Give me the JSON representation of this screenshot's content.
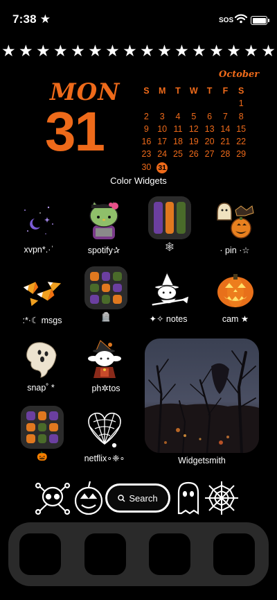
{
  "status_bar": {
    "time": "7:38 ★",
    "sos": "SOS"
  },
  "header_stars": [
    "★",
    "★",
    "★",
    "★",
    "★",
    "★",
    "★",
    "★",
    "★",
    "★",
    "★",
    "★",
    "★",
    "★",
    "★",
    "★"
  ],
  "date_widget": {
    "day_name": "MON",
    "day_number": "31"
  },
  "calendar": {
    "month": "October",
    "weekdays": [
      "S",
      "M",
      "T",
      "W",
      "T",
      "F",
      "S"
    ],
    "weeks": [
      [
        "",
        "",
        "",
        "",
        "",
        "",
        "1"
      ],
      [
        "2",
        "3",
        "4",
        "5",
        "6",
        "7",
        "8"
      ],
      [
        "9",
        "10",
        "11",
        "12",
        "13",
        "14",
        "15"
      ],
      [
        "16",
        "17",
        "18",
        "19",
        "20",
        "21",
        "22"
      ],
      [
        "23",
        "24",
        "25",
        "26",
        "27",
        "28",
        "29"
      ],
      [
        "30",
        "31",
        "",
        "",
        "",
        "",
        ""
      ]
    ],
    "today": "31",
    "accent": "#ee6a1a"
  },
  "widget_label": "Color Widgets",
  "apps": {
    "xvpn": "xvpn*.·ˈ",
    "spotify": "spotify✰",
    "folder1": "🕸",
    "pin": "· pin ·☆",
    "msgs": ":*·☾ msgs",
    "folder2": "🪦",
    "notes": "✦✧ notes",
    "cam": "cam ★",
    "snap": "snap˚ *",
    "photos": "ph✲tos",
    "folder3": "🎃",
    "netflix": "netflix∘❈∘"
  },
  "widgetsmith_label": "Widgetsmith",
  "search": {
    "icon": "search-icon",
    "label": "Search"
  },
  "folder_colors": [
    "#6b3fa0",
    "#e0781f",
    "#4a6b2a"
  ]
}
